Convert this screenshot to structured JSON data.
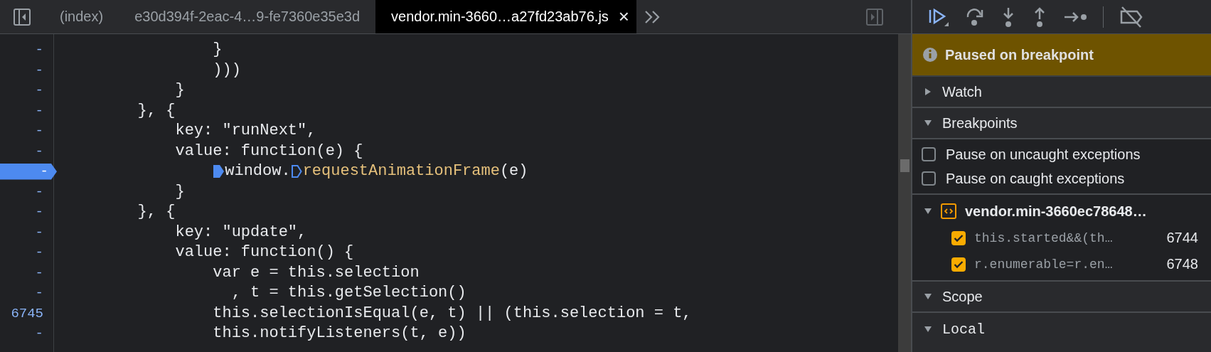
{
  "tabs": [
    {
      "label": "(index)",
      "selected": false
    },
    {
      "label": "e30d394f-2eac-4…9-fe7360e35e3d",
      "selected": false
    },
    {
      "label": "vendor.min-3660…a27fd23ab76.js",
      "selected": true,
      "close": "×"
    }
  ],
  "code_lines": [
    {
      "number": "-",
      "selected": false,
      "segments": [
        {
          "kind": "plain",
          "text": "                }"
        }
      ]
    },
    {
      "number": "-",
      "selected": false,
      "segments": [
        {
          "kind": "plain",
          "text": "                )))"
        }
      ]
    },
    {
      "number": "-",
      "selected": false,
      "segments": [
        {
          "kind": "plain",
          "text": "            }"
        }
      ]
    },
    {
      "number": "-",
      "selected": false,
      "segments": [
        {
          "kind": "plain",
          "text": "        }, {"
        }
      ]
    },
    {
      "number": "-",
      "selected": false,
      "segments": [
        {
          "kind": "plain",
          "text": "            key: \"runNext\","
        }
      ]
    },
    {
      "number": "-",
      "selected": false,
      "segments": [
        {
          "kind": "plain",
          "text": "            value: function(e) {"
        }
      ]
    },
    {
      "number": "-",
      "selected": true,
      "segments": [
        {
          "kind": "marker",
          "active": true,
          "text": "                window."
        },
        {
          "kind": "marker-call",
          "active": false,
          "text": "requestAnimationFrame"
        },
        {
          "kind": "plain",
          "text": "(e)"
        }
      ]
    },
    {
      "number": "-",
      "selected": false,
      "segments": [
        {
          "kind": "plain",
          "text": "            }"
        }
      ]
    },
    {
      "number": "-",
      "selected": false,
      "segments": [
        {
          "kind": "plain",
          "text": "        }, {"
        }
      ]
    },
    {
      "number": "-",
      "selected": false,
      "segments": [
        {
          "kind": "plain",
          "text": "            key: \"update\","
        }
      ]
    },
    {
      "number": "-",
      "selected": false,
      "segments": [
        {
          "kind": "plain",
          "text": "            value: function() {"
        }
      ]
    },
    {
      "number": "-",
      "selected": false,
      "segments": [
        {
          "kind": "plain",
          "text": "                var e = this.selection"
        }
      ]
    },
    {
      "number": "-",
      "selected": false,
      "segments": [
        {
          "kind": "plain",
          "text": "                  , t = this.getSelection()"
        }
      ]
    },
    {
      "number": "6745",
      "selected": false,
      "segments": [
        {
          "kind": "plain",
          "text": "                this.selectionIsEqual(e, t) || (this.selection = t,"
        }
      ]
    },
    {
      "number": "-",
      "selected": false,
      "segments": [
        {
          "kind": "plain",
          "text": "                this.notifyListeners(t, e))"
        }
      ]
    }
  ],
  "status_banner": "Paused on breakpoint",
  "sections": [
    {
      "kind": "watch",
      "title": "Watch",
      "expanded": false
    },
    {
      "kind": "breakpoints",
      "title": "Breakpoints",
      "expanded": true,
      "options": [
        {
          "label": "Pause on uncaught exceptions",
          "checked": false
        },
        {
          "label": "Pause on caught exceptions",
          "checked": false
        }
      ],
      "files": [
        {
          "name": "vendor.min-3660ec78648…",
          "expanded": true,
          "breakpoints": [
            {
              "code": "this.started&&(th…",
              "line": "6744",
              "checked": true
            },
            {
              "code": "r.enumerable=r.en…",
              "line": "6748",
              "checked": true
            }
          ]
        }
      ]
    },
    {
      "kind": "scope",
      "title": "Scope",
      "expanded": true,
      "scopes": [
        {
          "title": "Local",
          "expanded": true
        }
      ]
    }
  ]
}
